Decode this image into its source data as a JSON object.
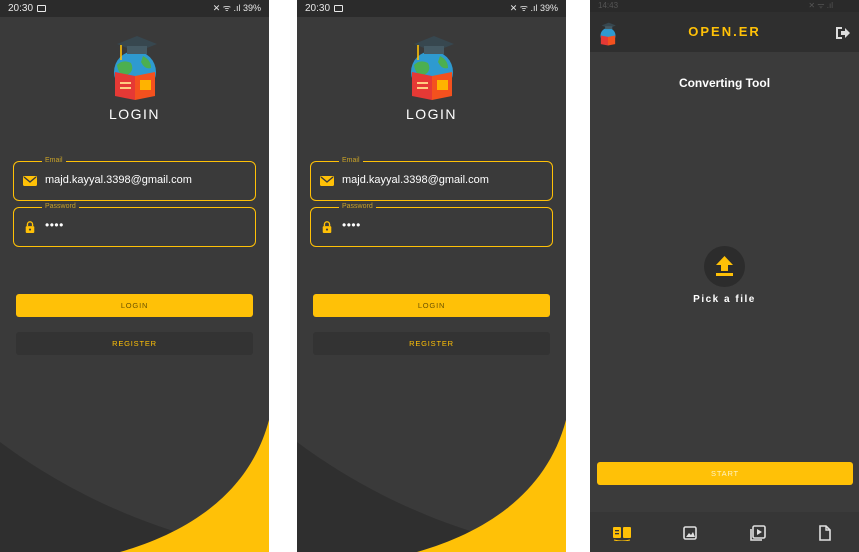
{
  "screens": [
    {
      "status_time": "20:30",
      "status_right": "✕ ᯤ .ıl 39%",
      "title": "LOGIN",
      "email_legend": "Email",
      "email_value": "majd.kayyal.3398@gmail.com",
      "password_legend": "Password",
      "password_value": "••••",
      "login_button": "LOGIN",
      "register_button": "REGISTER"
    },
    {
      "status_time": "20:30",
      "status_right": "✕ ᯤ .ıl 39%",
      "title": "LOGIN",
      "email_legend": "Email",
      "email_value": "majd.kayyal.3398@gmail.com",
      "password_legend": "Password",
      "password_value": "••••",
      "login_button": "LOGIN",
      "register_button": "REGISTER"
    }
  ],
  "converter": {
    "status_time": "14:43",
    "status_right": "✕ ᯤ .ıl",
    "app_title": "OPEN.ER",
    "page_title": "Converting Tool",
    "pick_label": "Pick a file",
    "start_button": "START",
    "nav": [
      "documents-icon",
      "image-icon",
      "video-icon",
      "file-icon"
    ]
  },
  "colors": {
    "accent": "#ffc107",
    "background": "#3a3a3a",
    "wave": "#2f2f2f"
  }
}
